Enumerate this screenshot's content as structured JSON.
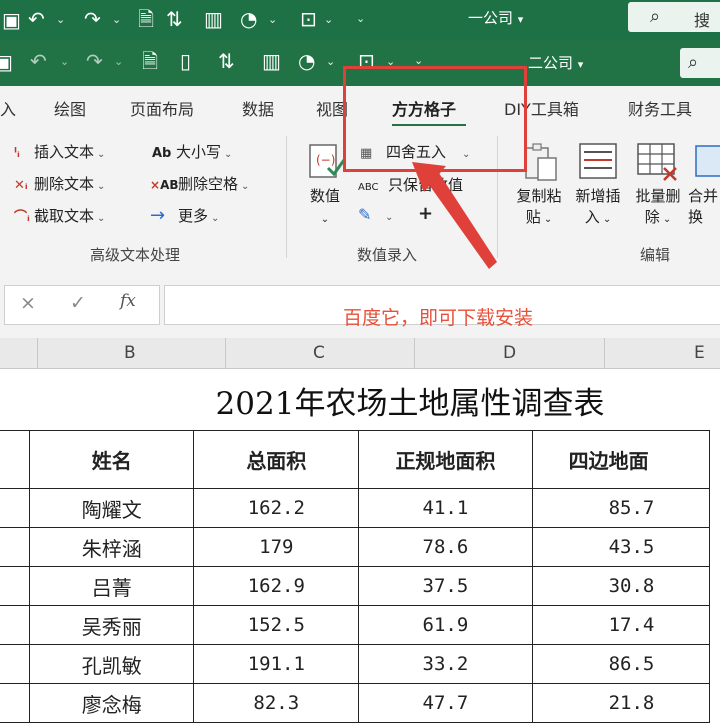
{
  "titlebar_top": {
    "title": "一公司",
    "search_label": "搜"
  },
  "titlebar_main": {
    "title": "二公司"
  },
  "ribbon_tabs": [
    {
      "label": "入"
    },
    {
      "label": "绘图"
    },
    {
      "label": "页面布局"
    },
    {
      "label": "数据"
    },
    {
      "label": "视图"
    },
    {
      "label": "方方格子",
      "active": true
    },
    {
      "label": "DIY工具箱"
    },
    {
      "label": "财务工具"
    }
  ],
  "group_text": {
    "insert_text": "插入文本",
    "delete_text": "删除文本",
    "extract_text": "截取文本",
    "case": "大小写",
    "delete_space": "删除空格",
    "more": "更多",
    "label": "高级文本处理"
  },
  "group_number": {
    "value_button": "数值",
    "round": "四舍五入",
    "keep_value": "只保留数值",
    "label": "数值录入"
  },
  "group_edit": {
    "copy_paste_l1": "复制粘",
    "copy_paste_l2": "贴",
    "batch_insert_l1": "新增插",
    "batch_insert_l2": "入",
    "batch_delete_l1": "批量删",
    "batch_delete_l2": "除",
    "merge_l1": "合并",
    "merge_l2": "换",
    "label": "编辑"
  },
  "formula_bar": {
    "cancel": "×",
    "confirm": "✓",
    "fx": "fx",
    "annotation": "百度它，即可下载安装"
  },
  "columns": [
    "B",
    "C",
    "D",
    "E"
  ],
  "sheet": {
    "title": "2021年农场土地属性调查表",
    "headers": [
      "姓名",
      "总面积",
      "正规地面积",
      "四边地面"
    ],
    "rows": [
      [
        "陶耀文",
        "162.2",
        "41.1",
        "85.7"
      ],
      [
        "朱梓涵",
        "179",
        "78.6",
        "43.5"
      ],
      [
        "吕菁",
        "162.9",
        "37.5",
        "30.8"
      ],
      [
        "吴秀丽",
        "152.5",
        "61.9",
        "17.4"
      ],
      [
        "孔凯敏",
        "191.1",
        "33.2",
        "86.5"
      ],
      [
        "廖念梅",
        "82.3",
        "47.7",
        "21.8"
      ]
    ]
  },
  "colors": {
    "title_bar": "#217346",
    "accent_red": "#e0403a"
  }
}
